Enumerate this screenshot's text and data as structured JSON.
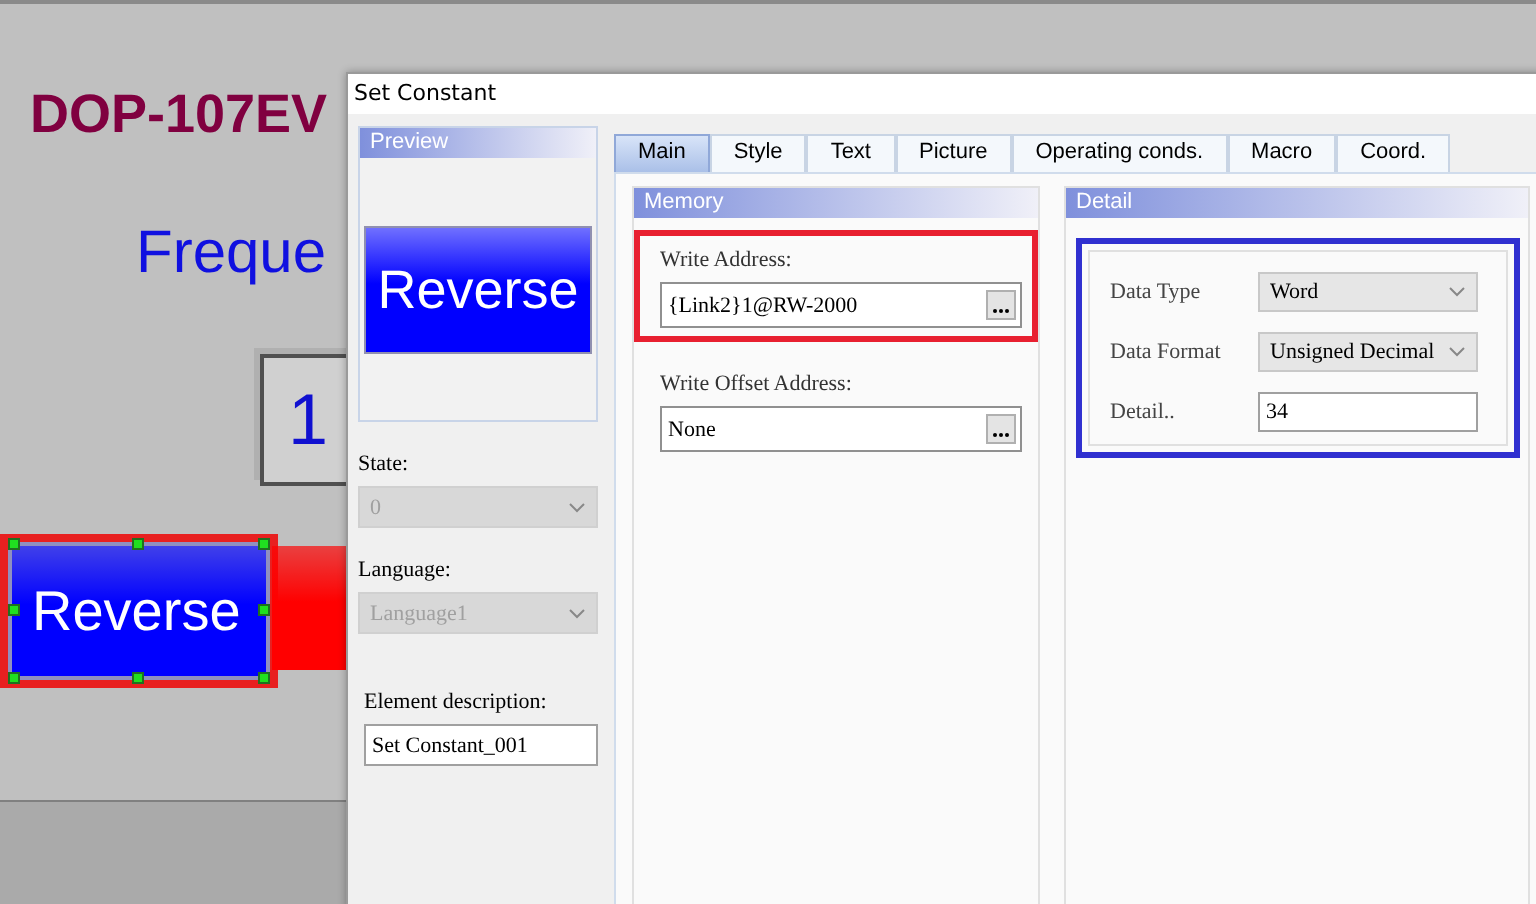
{
  "canvas": {
    "title": "DOP-107EV",
    "label": "Freque",
    "value": "1",
    "buttons": [
      {
        "label": "Reverse",
        "color": "#0000ff",
        "selected": true
      },
      {
        "color": "#ff0000",
        "selected": false
      }
    ]
  },
  "dialog": {
    "title": "Set Constant",
    "preview": {
      "header": "Preview",
      "button_label": "Reverse"
    },
    "state": {
      "label": "State:",
      "value": "0",
      "disabled": true
    },
    "language": {
      "label": "Language:",
      "value": "Language1",
      "disabled": true
    },
    "element_description": {
      "label": "Element description:",
      "value": "Set Constant_001"
    },
    "tabs": [
      {
        "label": "Main",
        "selected": true
      },
      {
        "label": "Style",
        "selected": false
      },
      {
        "label": "Text",
        "selected": false
      },
      {
        "label": "Picture",
        "selected": false
      },
      {
        "label": "Operating conds.",
        "selected": false
      },
      {
        "label": "Macro",
        "selected": false
      },
      {
        "label": "Coord.",
        "selected": false
      }
    ],
    "memory": {
      "header": "Memory",
      "fields": [
        {
          "label": "Write Address:",
          "value": "{Link2}1@RW-2000",
          "highlighted": true
        },
        {
          "label": "Write Offset Address:",
          "value": "None",
          "highlighted": false
        }
      ]
    },
    "detail": {
      "header": "Detail",
      "highlighted": true,
      "rows": [
        {
          "kind": "select",
          "label": "Data Type",
          "value": "Word"
        },
        {
          "kind": "select",
          "label": "Data Format",
          "value": "Unsigned Decimal"
        },
        {
          "kind": "input",
          "label": "Detail..",
          "value": "34"
        }
      ]
    }
  }
}
